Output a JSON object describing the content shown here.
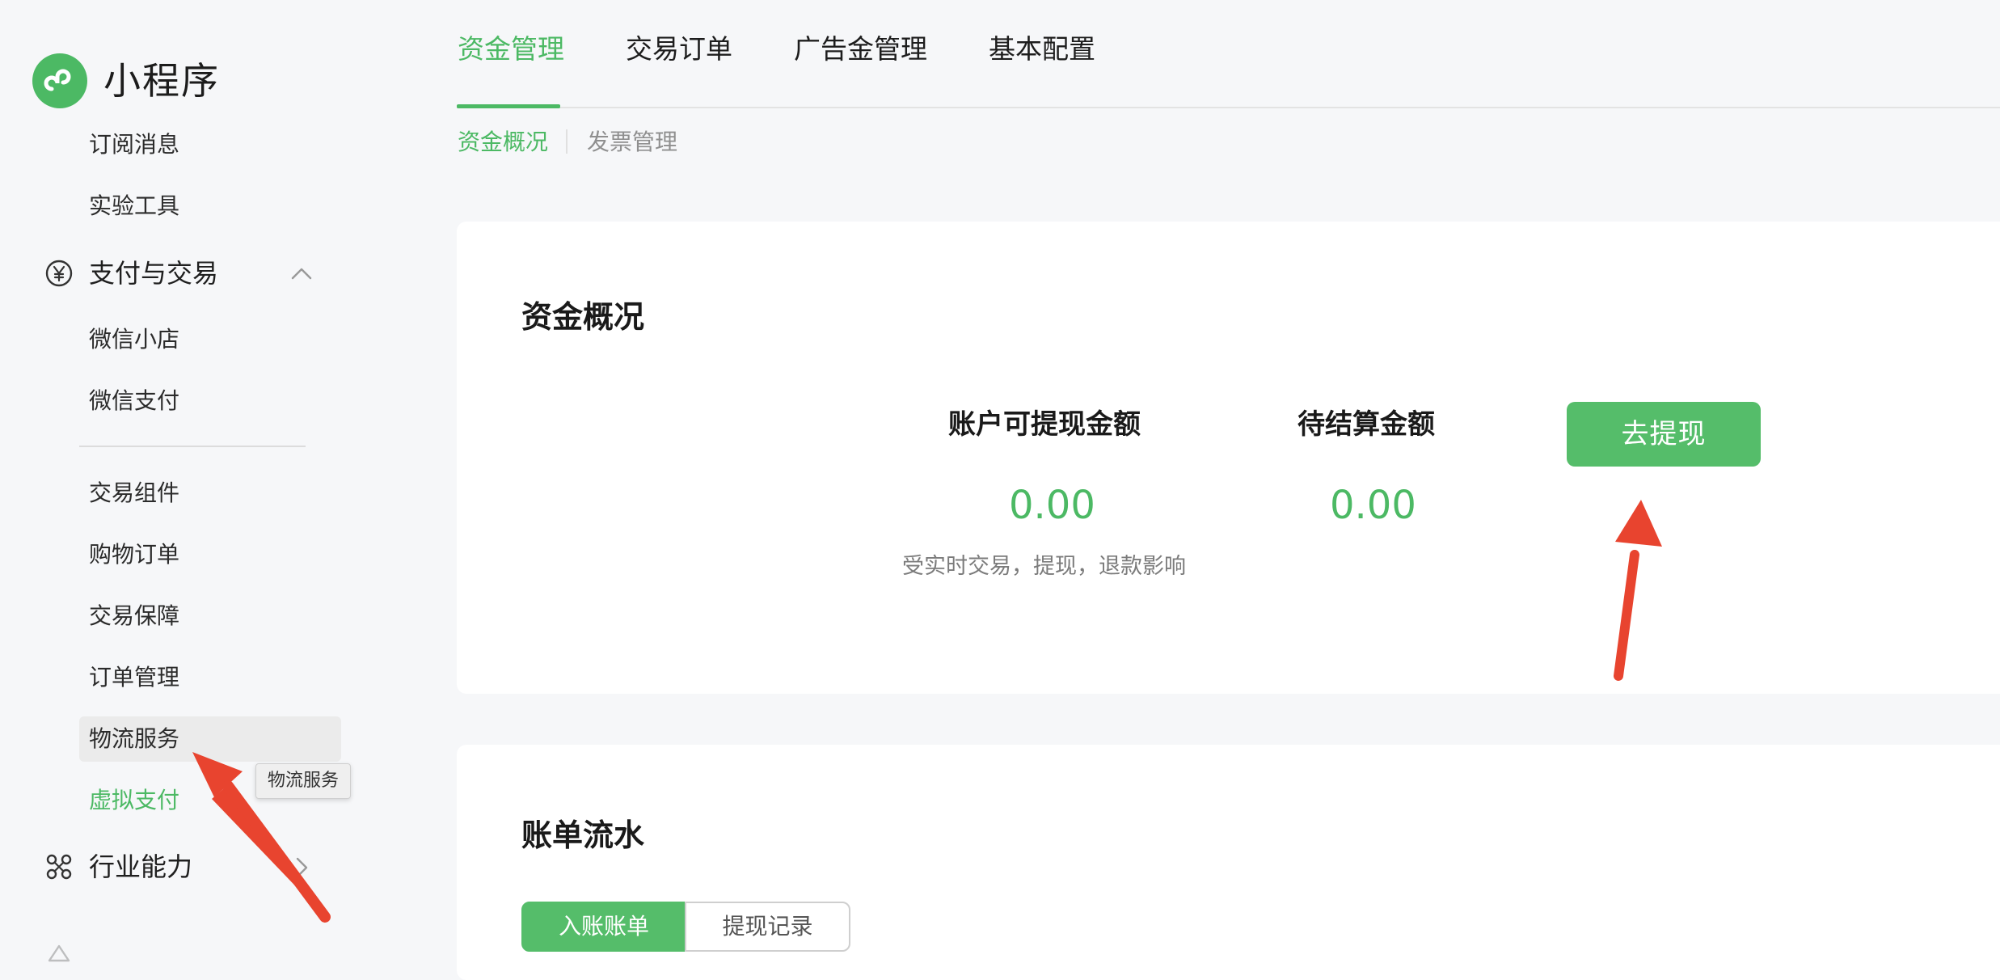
{
  "app": {
    "brand": "小程序"
  },
  "colors": {
    "accent": "#4cb964",
    "annotation_arrow": "#e8442f"
  },
  "sidebar": {
    "items_top": [
      {
        "label": "订阅消息"
      },
      {
        "label": "实验工具"
      }
    ],
    "group_payment": {
      "label": "支付与交易",
      "icon": "yen-circle-icon",
      "expanded": true
    },
    "payment_items_a": [
      {
        "label": "微信小店"
      },
      {
        "label": "微信支付"
      }
    ],
    "payment_items_b": [
      {
        "label": "交易组件"
      },
      {
        "label": "购物订单"
      },
      {
        "label": "交易保障"
      },
      {
        "label": "订单管理"
      },
      {
        "label": "物流服务",
        "hovered": true
      },
      {
        "label": "虚拟支付",
        "active": true
      }
    ],
    "tooltip": "物流服务",
    "group_industry": {
      "label": "行业能力",
      "icon": "industry-nodes-icon",
      "expanded": false
    }
  },
  "main": {
    "top_tabs": [
      {
        "label": "资金管理",
        "active": true
      },
      {
        "label": "交易订单"
      },
      {
        "label": "广告金管理"
      },
      {
        "label": "基本配置"
      }
    ],
    "sub_tabs": [
      {
        "label": "资金概况",
        "active": true
      },
      {
        "label": "发票管理"
      }
    ],
    "overview": {
      "title": "资金概况",
      "withdrawable_label": "账户可提现金额",
      "withdrawable_value": "0.00",
      "withdrawable_note": "受实时交易，提现，退款影响",
      "pending_label": "待结算金额",
      "pending_value": "0.00",
      "withdraw_button": "去提现"
    },
    "bills": {
      "title": "账单流水",
      "tabs": [
        {
          "label": "入账账单",
          "active": true
        },
        {
          "label": "提现记录"
        }
      ]
    }
  }
}
